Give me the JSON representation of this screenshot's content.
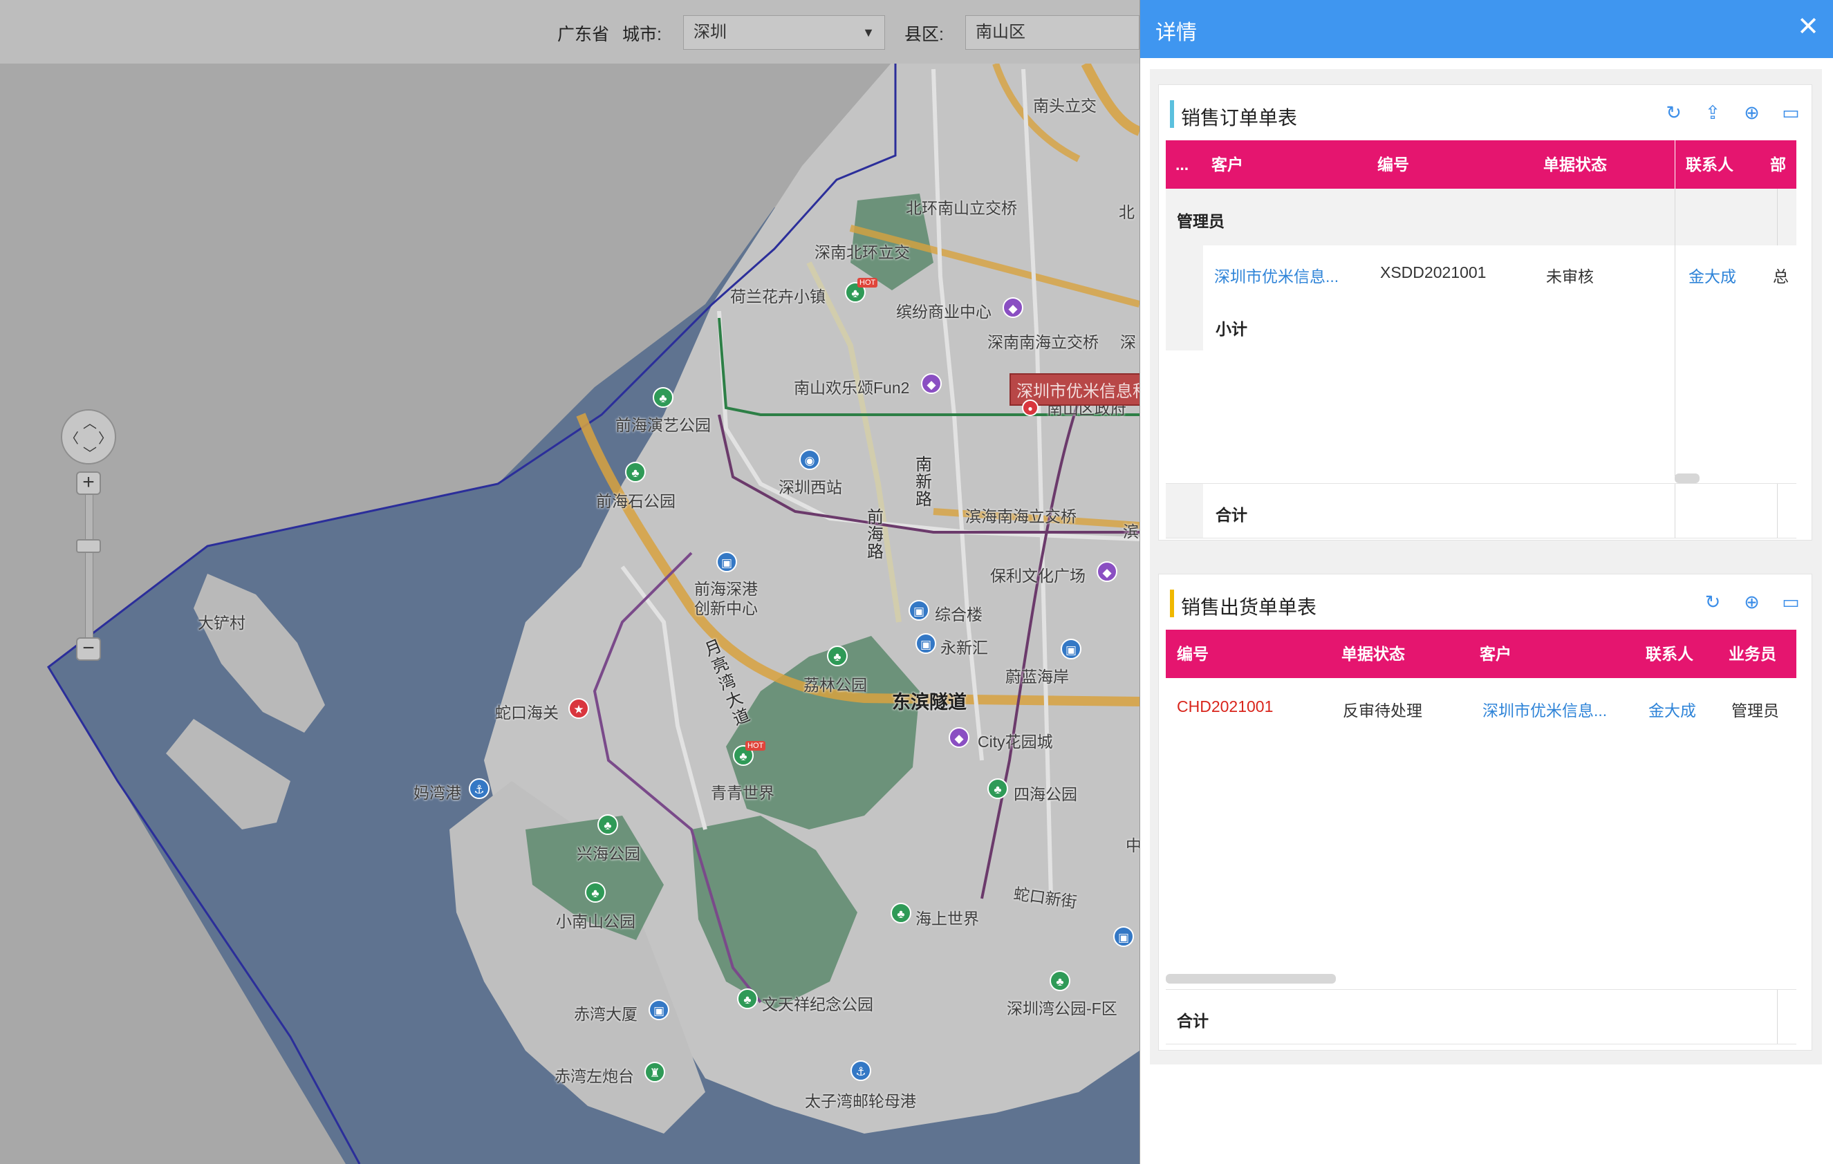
{
  "filter": {
    "province_label": "广东省",
    "city_label": "城市:",
    "city_value": "深圳",
    "district_label": "县区:",
    "district_value": "南山区"
  },
  "map": {
    "popup_text": "深圳市优米信息科",
    "hot_tag": "HOT",
    "labels": {
      "nantou": "南头立交",
      "beihuan_nanshan": "北环南山立交桥",
      "beihuan_short": "北",
      "shennan_beihuan": "深南北环立交",
      "helan": "荷兰花卉小镇",
      "binfen": "缤纷商业中心",
      "shennan_nanhai": "深南南海立交桥",
      "shen_short": "深",
      "nanshan_fun2": "南山欢乐颂Fun2",
      "nanshan_gov": "南山区政府",
      "qianhai_yanyi": "前海演艺公园",
      "shenzhen_west": "深圳西站",
      "nanxin_road": "南新路",
      "qianhai_road": "前海路",
      "binhai_nanhai": "滨海南海立交桥",
      "bin_short": "滨",
      "qianhai_shi": "前海石公园",
      "qianhai_shengang": "前海深港创新中心",
      "baoli": "保利文化广场",
      "dachan": "大铲村",
      "yueliang": "月亮湾大道",
      "zonghe": "综合楼",
      "yongxin": "永新汇",
      "lizhi": "荔林公园",
      "dongbin": "东滨隧道",
      "weilan": "蔚蓝海岸",
      "shekou_haiguan": "蛇口海关",
      "city_garden": "City花园城",
      "qingqing": "青青世界",
      "mawan": "妈湾港",
      "sihai": "四海公园",
      "xinghai": "兴海公园",
      "zhong_short": "中",
      "xiaonanshan": "小南山公园",
      "shekou_xinjie": "蛇口新街",
      "haishang": "海上世界",
      "wentianxiang": "文天祥纪念公园",
      "chiwan_dasha": "赤湾大厦",
      "shenzhenwan_f": "深圳湾公园-F区",
      "chiwan_paotai": "赤湾左炮台",
      "taizi": "太子湾邮轮母港"
    }
  },
  "panel": {
    "title": "详情",
    "close_glyph": "✕",
    "sales_order": {
      "title": "销售订单单表",
      "tool_icons": [
        "refresh-icon",
        "upload-icon",
        "add-icon",
        "maximize-icon"
      ],
      "columns": [
        "...",
        "客户",
        "编号",
        "单据状态",
        "联系人",
        "部"
      ],
      "group_label": "管理员",
      "row": {
        "customer": "深圳市优米信息...",
        "number": "XSDD2021001",
        "status": "未审核",
        "contact": "金大成",
        "dept": "总"
      },
      "subtotal_label": "小计",
      "total_label": "合计"
    },
    "sales_delivery": {
      "title": "销售出货单单表",
      "tool_icons": [
        "refresh-icon",
        "add-icon",
        "maximize-icon"
      ],
      "columns": [
        "编号",
        "单据状态",
        "客户",
        "联系人",
        "业务员"
      ],
      "row": {
        "number": "CHD2021001",
        "status": "反审待处理",
        "customer": "深圳市优米信息...",
        "contact": "金大成",
        "salesman": "管理员"
      },
      "total_label": "合计"
    },
    "colors": {
      "header_blue": "#3f96f0",
      "table_header_pink": "#e5156f",
      "accent_cyan": "#5bc0de",
      "accent_yellow": "#f0b800",
      "link_blue": "#2f84d8",
      "red_number": "#d9251c"
    }
  }
}
